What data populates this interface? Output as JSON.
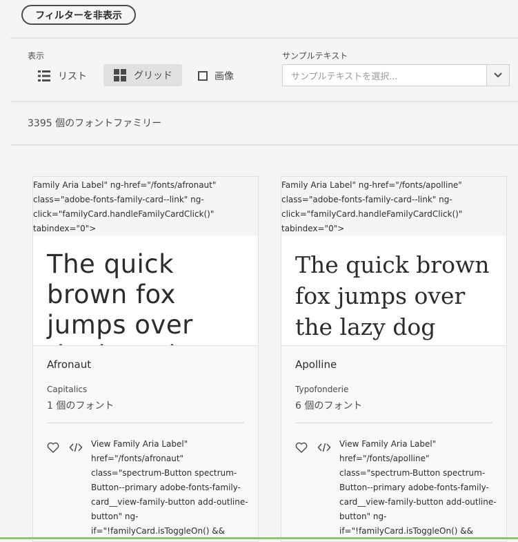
{
  "filter_button": {
    "label": "フィルターを非表示"
  },
  "display": {
    "label": "表示",
    "list_label": "リスト",
    "grid_label": "グリッド",
    "image_label": "画像"
  },
  "sample_text": {
    "label": "サンプルテキスト",
    "placeholder": "サンプルテキストを選択..."
  },
  "result_count": "3395 個のフォントファミリー",
  "cards": [
    {
      "raw_link_text": "Family Aria Label\" ng-href=\"/fonts/afronaut\" class=\"adobe-fonts-family-card--link\" ng-click=\"familyCard.handleFamilyCardClick()\" tabindex=\"0\">",
      "preview_text": "The quick brown fox jumps over the lazy dog",
      "family_name": "Afronaut",
      "foundry": "Capitalics",
      "font_count": "1 個のフォント",
      "raw_button_text": "View Family Aria Label\" href=\"/fonts/afronaut\" class=\"spectrum-Button spectrum-Button--primary adobe-fonts-family-card__view-family-button add-outline-button\" ng-if=\"!familyCard.isToggleOn() &&"
    },
    {
      "raw_link_text": "Family Aria Label\" ng-href=\"/fonts/apolline\" class=\"adobe-fonts-family-card--link\" ng-click=\"familyCard.handleFamilyCardClick()\" tabindex=\"0\">",
      "preview_text": "The quick brown fox jumps over the lazy dog",
      "family_name": "Apolline",
      "foundry": "Typofonderie",
      "font_count": "6 個のフォント",
      "raw_button_text": "View Family Aria Label\" href=\"/fonts/apolline\" class=\"spectrum-Button spectrum-Button--primary adobe-fonts-family-card__view-family-button add-outline-button\" ng-if=\"!familyCard.isToggleOn() &&"
    }
  ],
  "icons": {
    "list": "list-icon",
    "grid": "grid-icon",
    "checkbox": "checkbox-icon",
    "dropdown": "chevron-down-icon",
    "favorite": "heart-icon",
    "code": "code-icon"
  },
  "colors": {
    "background": "#f5f5f5",
    "selected_view": "#e1e1e1",
    "accent_bottom": "#8fc46a"
  }
}
